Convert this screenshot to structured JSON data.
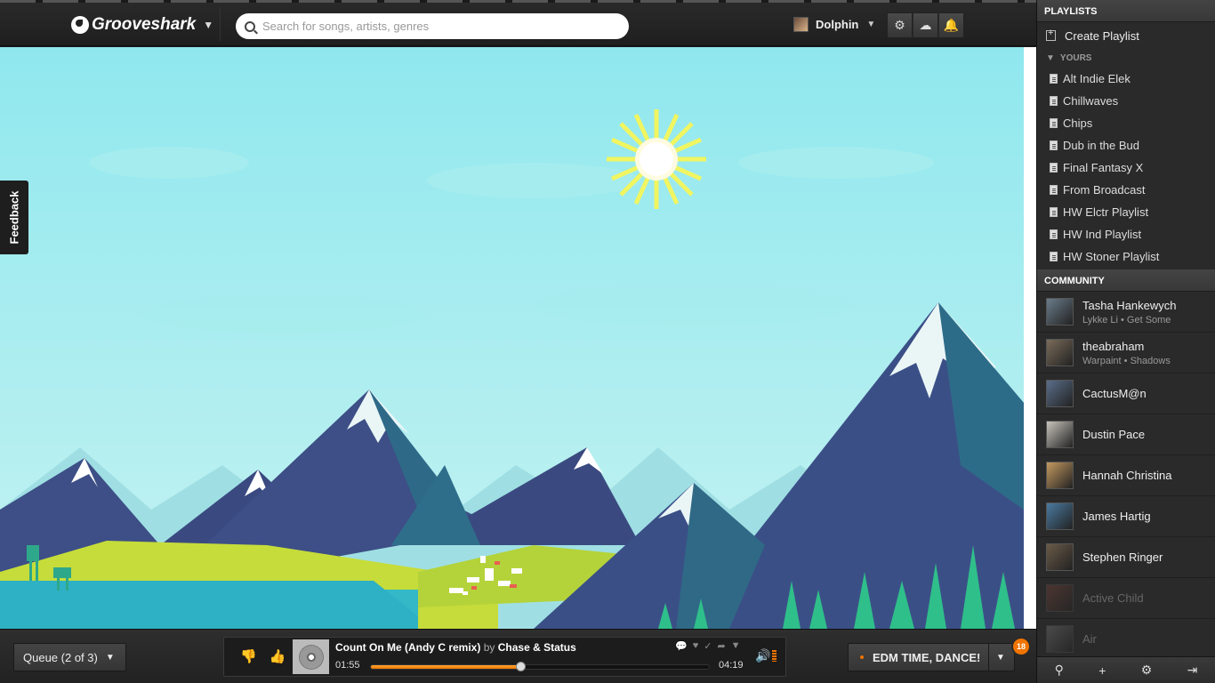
{
  "header": {
    "logo_text": "Grooveshark",
    "search_placeholder": "Search for songs, artists, genres",
    "user_name": "Dolphin",
    "buttons": [
      "gear-icon",
      "cloud-upload-icon",
      "bell-icon"
    ]
  },
  "feedback_label": "Feedback",
  "sidebar": {
    "playlists_header": "PLAYLISTS",
    "create_playlist": "Create Playlist",
    "yours_label": "YOURS",
    "playlists": [
      "Alt Indie Elek",
      "Chillwaves",
      "Chips",
      "Dub in the Bud",
      "Final Fantasy X",
      "From Broadcast",
      "HW Elctr Playlist",
      "HW Ind Playlist",
      "HW Stoner Playlist"
    ],
    "community_header": "COMMUNITY",
    "community": [
      {
        "name": "Tasha Hankewych",
        "sub": "Lykke Li • Get Some",
        "color": "#6a7c8a"
      },
      {
        "name": "theabraham",
        "sub": "Warpaint • Shadows",
        "color": "#7a6b5a"
      },
      {
        "name": "CactusM@n",
        "sub": "",
        "color": "#5a6e8a"
      },
      {
        "name": "Dustin Pace",
        "sub": "",
        "color": "#c8c4bc"
      },
      {
        "name": "Hannah Christina",
        "sub": "",
        "color": "#c49a60"
      },
      {
        "name": "James Hartig",
        "sub": "",
        "color": "#4a7aa0"
      },
      {
        "name": "Stephen Ringer",
        "sub": "",
        "color": "#6a5a48"
      },
      {
        "name": "Active Child",
        "sub": "",
        "color": "#8a4a3a",
        "dim": true
      },
      {
        "name": "Air",
        "sub": "",
        "color": "#888888",
        "dim": true
      }
    ],
    "footer_icons": [
      "search-icon",
      "plus-icon",
      "gear-icon",
      "sidebar-toggle-icon"
    ]
  },
  "player": {
    "queue_label": "Queue (2 of 3)",
    "song_title": "Count On Me (Andy C remix)",
    "by_label": "by",
    "artist": "Chase & Status",
    "time_current": "01:55",
    "time_total": "04:19",
    "progress_fraction": 0.444,
    "volume_muted": false,
    "station_label": "EDM TIME, DANCE!",
    "notification_count": "18"
  },
  "colors": {
    "accent": "#f07400",
    "sky": "#8fe6ec"
  }
}
